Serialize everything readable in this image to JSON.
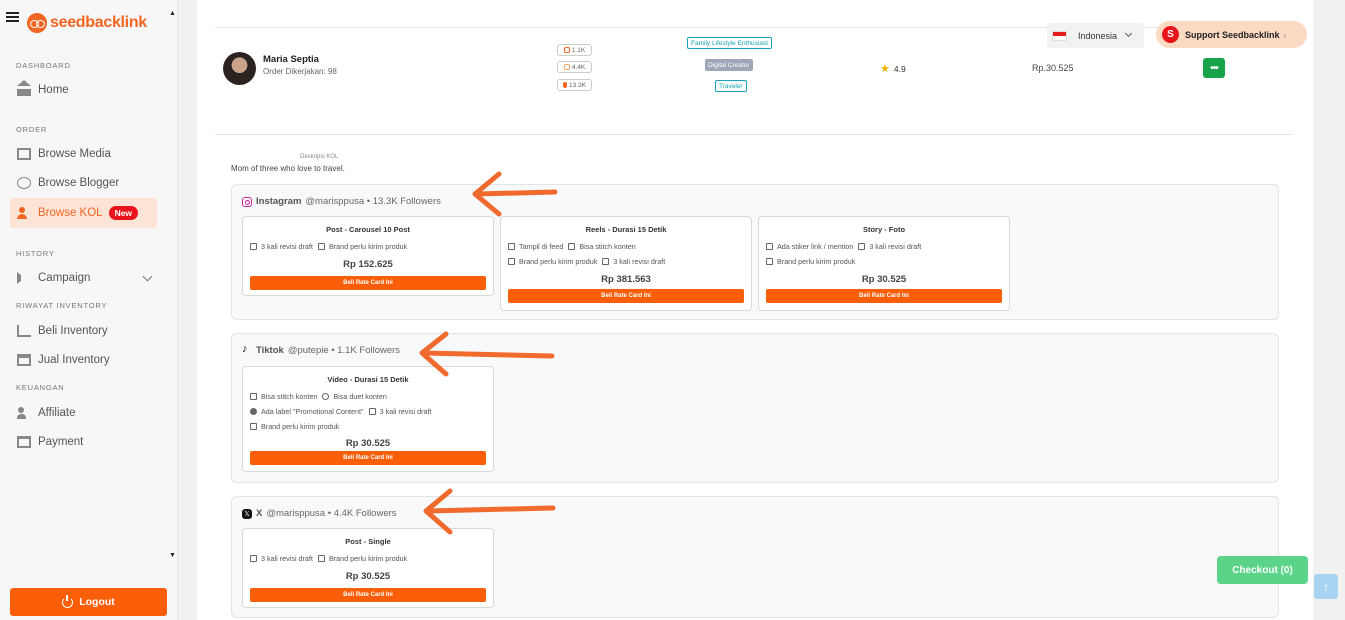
{
  "sidebar": {
    "logo_text": "seedbacklink",
    "sections": {
      "dashboard": "DASHBOARD",
      "order": "ORDER",
      "history": "HISTORY",
      "riwayat_inventory": "RIWAYAT INVENTORY",
      "keuangan": "KEUANGAN"
    },
    "items": {
      "home": "Home",
      "browse_media": "Browse Media",
      "browse_blogger": "Browse Blogger",
      "browse_kol": "Browse KOL",
      "browse_kol_badge": "New",
      "campaign": "Campaign",
      "beli_inventory": "Beli Inventory",
      "jual_inventory": "Jual Inventory",
      "affiliate": "Affiliate",
      "payment": "Payment"
    },
    "logout_label": "Logout"
  },
  "header": {
    "language": "Indonesia",
    "support_label": "Support Seedbacklink",
    "support_icon_letter": "S"
  },
  "kol": {
    "name": "Maria Septia",
    "orders": "Order Dikerjakan: 98",
    "stats": [
      "1.1K",
      "4.4K",
      "13.3K"
    ],
    "tags": [
      "Family Lifestyle Enthusiast",
      "Digital Creator",
      "Traveler"
    ],
    "rating": "4.9",
    "price": "Rp.30.525",
    "more_label": "•••",
    "description_label": "Deskripsi KOL",
    "description": "Mom of three who love to travel."
  },
  "platforms": {
    "instagram": {
      "name": "Instagram",
      "handle": "@marisppusa • 13.3K Followers",
      "cards": [
        {
          "title": "Post - Carousel 10 Post",
          "features": [
            [
              "3 kali revisi draft",
              "Brand perlu kirim produk"
            ]
          ],
          "price": "Rp 152.625",
          "button": "Beli Rate Card Ini"
        },
        {
          "title": "Reels - Durasi 15 Detik",
          "features": [
            [
              "Tampil di feed",
              "Bisa stitch konten"
            ],
            [
              "Brand perlu kirim produk",
              "3 kali revisi draft"
            ]
          ],
          "price": "Rp 381.563",
          "button": "Beli Rate Card Ini"
        },
        {
          "title": "Story - Foto",
          "features": [
            [
              "Ada stiker link / mention",
              "3 kali revisi draft"
            ],
            [
              "Brand perlu kirim produk"
            ]
          ],
          "price": "Rp 30.525",
          "button": "Beli Rate Card Ini"
        }
      ]
    },
    "tiktok": {
      "name": "Tiktok",
      "handle": "@putepie • 1.1K Followers",
      "cards": [
        {
          "title": "Video - Durasi 15 Detik",
          "features": [
            [
              "Bisa stitch konten",
              "Bisa duet konten"
            ],
            [
              "Ada label \"Promotional Content\"",
              "3 kali revisi draft"
            ],
            [
              "Brand perlu kirim produk"
            ]
          ],
          "price": "Rp 30.525",
          "button": "Beli Rate Card Ini"
        }
      ]
    },
    "x": {
      "name": "X",
      "handle": "@marisppusa • 4.4K Followers",
      "cards": [
        {
          "title": "Post - Single",
          "features": [
            [
              "3 kali revisi draft",
              "Brand perlu kirim produk"
            ]
          ],
          "price": "Rp 30.525",
          "button": "Beli Rate Card Ini"
        }
      ]
    }
  },
  "checkout_label": "Checkout (0)",
  "colors": {
    "accent": "#fb5e08",
    "brand": "#f26522",
    "success": "#16a34a",
    "checkout": "#5bd48a",
    "annotation_arrow": "#ef6a2c"
  }
}
